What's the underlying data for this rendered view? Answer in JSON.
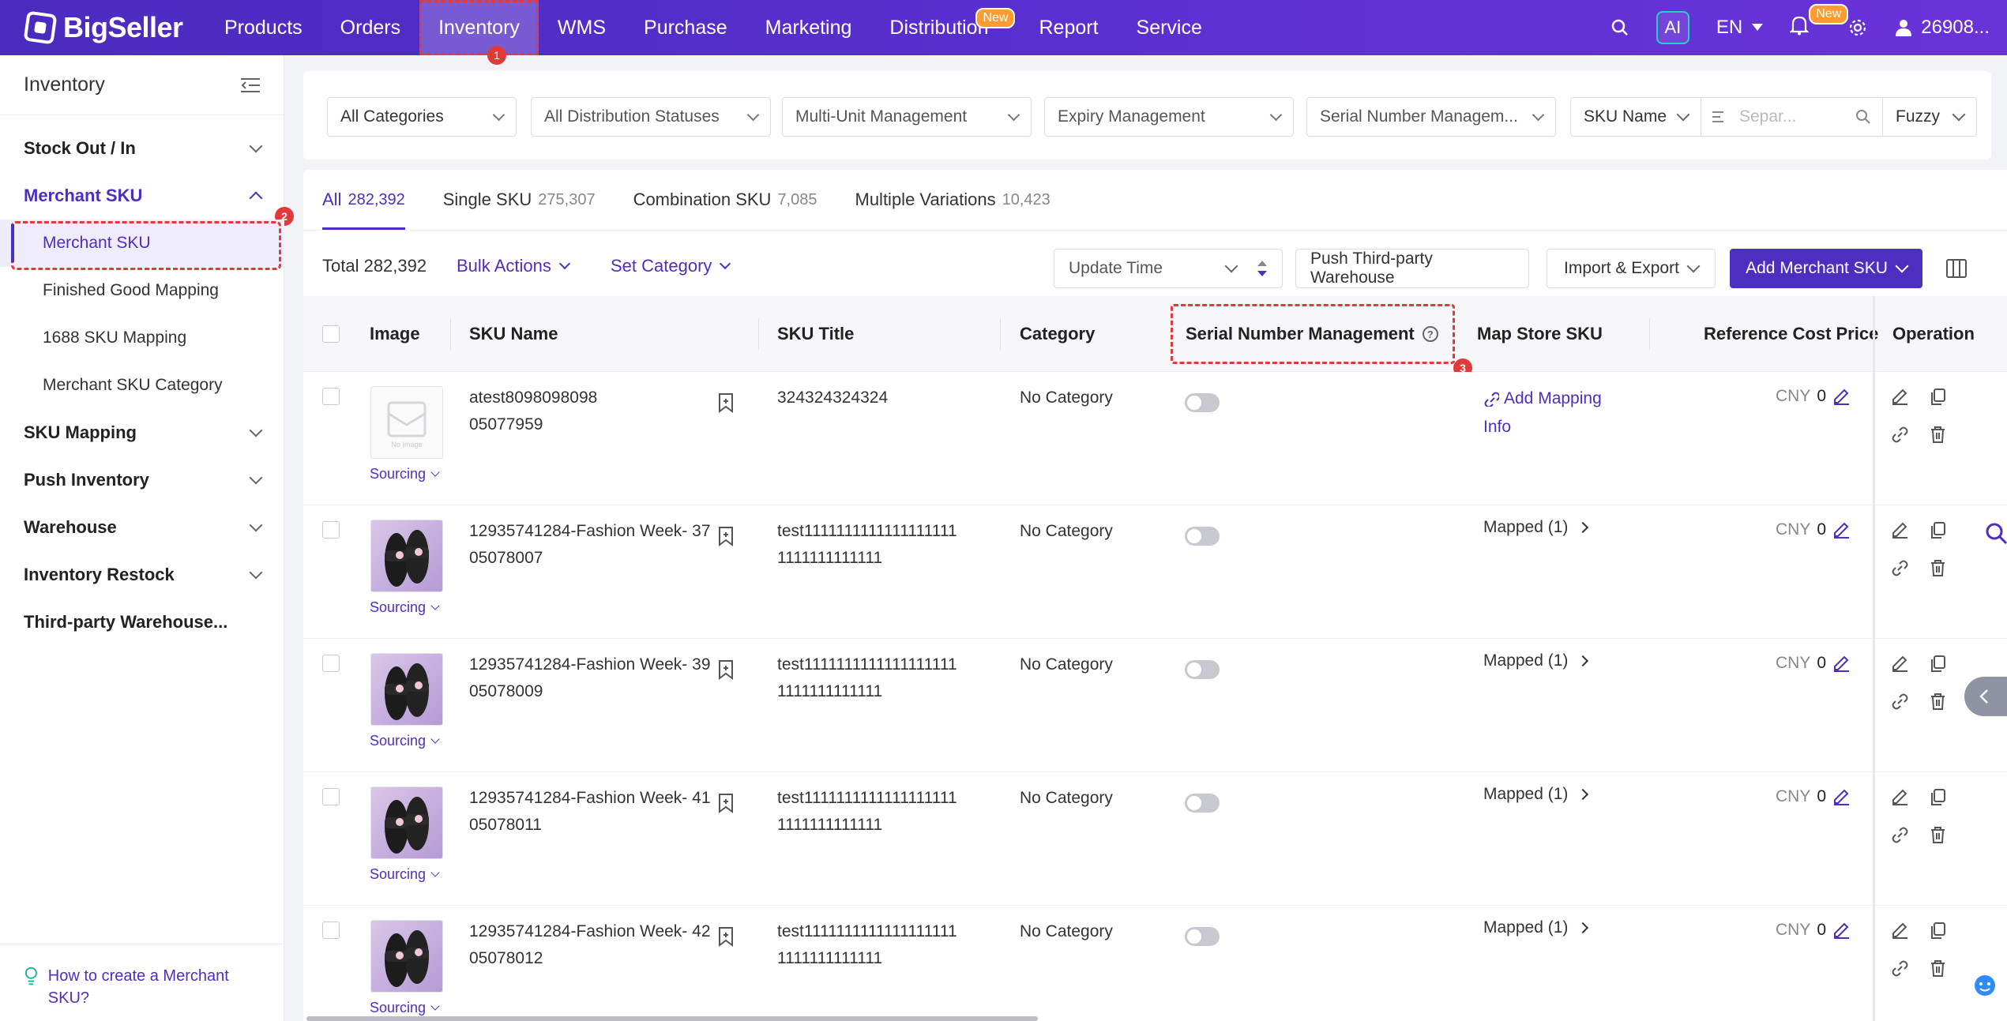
{
  "app": {
    "name": "BigSeller"
  },
  "nav": {
    "items": [
      "Products",
      "Orders",
      "Inventory",
      "WMS",
      "Purchase",
      "Marketing",
      "Distribution",
      "Report",
      "Service"
    ],
    "new_badge": "New",
    "active": "Inventory",
    "step_1": "1"
  },
  "top_right": {
    "ai": "AI",
    "lang": "EN",
    "notif_badge": "New",
    "account": "26908..."
  },
  "sidebar": {
    "title": "Inventory",
    "groups": [
      {
        "label": "Stock Out / In"
      },
      {
        "label": "Merchant SKU"
      },
      {
        "label": "SKU Mapping"
      },
      {
        "label": "Push Inventory"
      },
      {
        "label": "Warehouse"
      },
      {
        "label": "Inventory Restock"
      },
      {
        "label": "Third-party Warehouse..."
      }
    ],
    "sub_items": [
      "Merchant SKU",
      "Finished Good Mapping",
      "1688 SKU Mapping",
      "Merchant SKU Category"
    ],
    "step_2": "2",
    "help": "How to create a Merchant SKU?"
  },
  "filters": {
    "categories": "All Categories",
    "distribution": "All Distribution Statuses",
    "multi_unit": "Multi-Unit Management",
    "expiry": "Expiry Management",
    "serial": "Serial Number Managem...",
    "search_key": "SKU Name",
    "search_placeholder": "Separ...",
    "search_mode": "Fuzzy"
  },
  "tabs": [
    {
      "label": "All",
      "count": "282,392"
    },
    {
      "label": "Single SKU",
      "count": "275,307"
    },
    {
      "label": "Combination SKU",
      "count": "7,085"
    },
    {
      "label": "Multiple Variations",
      "count": "10,423"
    }
  ],
  "toolbar": {
    "total": "Total 282,392",
    "bulk_actions": "Bulk Actions",
    "set_category": "Set Category",
    "sort": "Update Time",
    "push_btn": "Push Third-party Warehouse",
    "import_export": "Import & Export",
    "add_btn": "Add Merchant SKU"
  },
  "columns": {
    "image": "Image",
    "sku_name": "SKU Name",
    "sku_title": "SKU Title",
    "category": "Category",
    "serial": "Serial Number Management",
    "map_store": "Map Store SKU",
    "ref_cost": "Reference Cost Price",
    "operation": "Operation",
    "step_3": "3"
  },
  "rows": [
    {
      "sku_line1": "atest8098098098",
      "sku_line2": "05077959",
      "title_line1": "324324324324",
      "title_line2": "",
      "category": "No Category",
      "map_type": "add",
      "map_text": "Add Mapping Info",
      "currency": "CNY",
      "cost": "0",
      "sourcing": "Sourcing",
      "image": "placeholder"
    },
    {
      "sku_line1": "12935741284-Fashion Week- 37",
      "sku_line2": "05078007",
      "title_line1": "test1111111111111111111",
      "title_line2": "1111111111111",
      "category": "No Category",
      "map_type": "mapped",
      "map_text": "Mapped (1)",
      "currency": "CNY",
      "cost": "0",
      "sourcing": "Sourcing",
      "image": "slipper"
    },
    {
      "sku_line1": "12935741284-Fashion Week- 39",
      "sku_line2": "05078009",
      "title_line1": "test1111111111111111111",
      "title_line2": "1111111111111",
      "category": "No Category",
      "map_type": "mapped",
      "map_text": "Mapped (1)",
      "currency": "CNY",
      "cost": "0",
      "sourcing": "Sourcing",
      "image": "slipper"
    },
    {
      "sku_line1": "12935741284-Fashion Week- 41",
      "sku_line2": "05078011",
      "title_line1": "test1111111111111111111",
      "title_line2": "1111111111111",
      "category": "No Category",
      "map_type": "mapped",
      "map_text": "Mapped (1)",
      "currency": "CNY",
      "cost": "0",
      "sourcing": "Sourcing",
      "image": "slipper"
    },
    {
      "sku_line1": "12935741284-Fashion Week- 42",
      "sku_line2": "05078012",
      "title_line1": "test1111111111111111111",
      "title_line2": "1111111111111",
      "category": "No Category",
      "map_type": "mapped",
      "map_text": "Mapped (1)",
      "currency": "CNY",
      "cost": "0",
      "sourcing": "Sourcing",
      "image": "slipper"
    }
  ],
  "colors": {
    "brand": "#4d2fc0",
    "annotation": "#e03a3a",
    "topbar": "#5a2fd0"
  }
}
